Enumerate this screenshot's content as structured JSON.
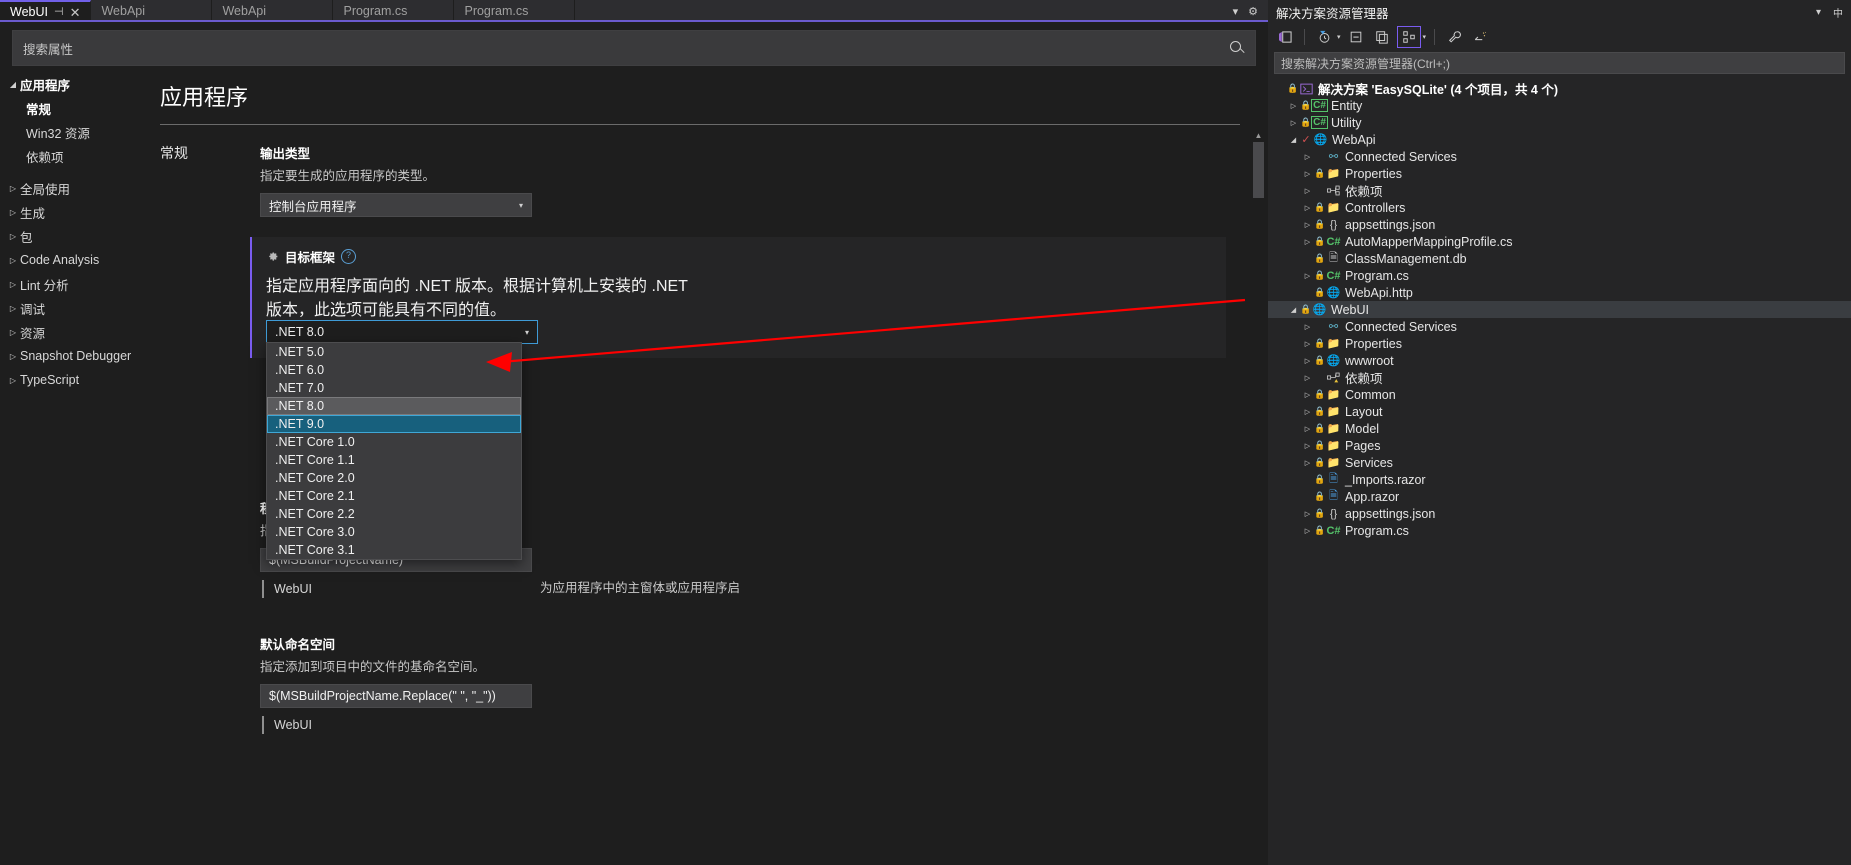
{
  "tabs": [
    {
      "label": "WebUI",
      "active": true,
      "pinned": true,
      "closable": true
    },
    {
      "label": "WebApi",
      "active": false
    },
    {
      "label": "WebApi",
      "active": false
    },
    {
      "label": "Program.cs",
      "active": false
    },
    {
      "label": "Program.cs",
      "active": false
    }
  ],
  "tabstrip": {
    "caret": "▾",
    "gear": "⚙"
  },
  "property_search": {
    "placeholder": "搜索属性"
  },
  "nav": {
    "items": [
      {
        "label": "应用程序",
        "level": 0,
        "expanded": true,
        "arrow": "◢"
      },
      {
        "label": "常规",
        "level": 1,
        "selected": true
      },
      {
        "label": "Win32 资源",
        "level": 1
      },
      {
        "label": "依赖项",
        "level": 1
      },
      {
        "label": "全局使用",
        "level": 0,
        "arrow": "▷"
      },
      {
        "label": "生成",
        "level": 0,
        "arrow": "▷"
      },
      {
        "label": "包",
        "level": 0,
        "arrow": "▷"
      },
      {
        "label": "Code Analysis",
        "level": 0,
        "arrow": "▷"
      },
      {
        "label": "Lint 分析",
        "level": 0,
        "arrow": "▷"
      },
      {
        "label": "调试",
        "level": 0,
        "arrow": "▷"
      },
      {
        "label": "资源",
        "level": 0,
        "arrow": "▷"
      },
      {
        "label": "Snapshot Debugger",
        "level": 0,
        "arrow": "▷"
      },
      {
        "label": "TypeScript",
        "level": 0,
        "arrow": "▷"
      }
    ]
  },
  "page": {
    "title": "应用程序",
    "section_name": "常规"
  },
  "fields": {
    "output_type": {
      "label": "输出类型",
      "desc": "指定要生成的应用程序的类型。",
      "value": "控制台应用程序",
      "caret": "▾"
    },
    "target_framework": {
      "label": "目标框架",
      "gear_icon": "gear-icon",
      "help_icon": "?",
      "desc": "指定应用程序面向的 .NET 版本。根据计算机上安装的 .NET 版本，此选项可能具有不同的值。",
      "value": ".NET 8.0",
      "caret": "▾",
      "options": [
        ".NET 5.0",
        ".NET 6.0",
        ".NET 7.0",
        ".NET 8.0",
        ".NET 9.0",
        ".NET Core 1.0",
        ".NET Core 1.1",
        ".NET Core 2.0",
        ".NET Core 2.1",
        ".NET Core 2.2",
        ".NET Core 3.0",
        ".NET Core 3.1"
      ],
      "hovered_option": ".NET 8.0",
      "selected_option": ".NET 9.0"
    },
    "startup_object": {
      "desc_tail": "为应用程序中的主窗体或应用程序启"
    },
    "assembly_name": {
      "label": "程序集名称",
      "desc": "指定将包含程序集清单的输出文件的名称。",
      "value": "$(MSBuildProjectName)",
      "resolved": "WebUI"
    },
    "default_namespace": {
      "label": "默认命名空间",
      "desc": "指定添加到项目中的文件的基命名空间。",
      "value": "$(MSBuildProjectName.Replace(\" \", \"_\"))",
      "resolved": "WebUI"
    }
  },
  "solution_explorer": {
    "title": "解决方案资源管理器",
    "header_caret": "▾",
    "header_pin": "中",
    "search_placeholder": "搜索解决方案资源管理器(Ctrl+;)",
    "toolbar": [
      {
        "name": "home-icon",
        "glyph": "⌂"
      },
      {
        "name": "pending-changes-icon",
        "glyph": "◔",
        "caret": true
      },
      {
        "name": "collapse-all-icon",
        "glyph": "⊟"
      },
      {
        "name": "show-all-files-icon",
        "glyph": "❐"
      },
      {
        "name": "view-switcher-icon",
        "glyph": "⁘",
        "caret": true,
        "active": true
      },
      {
        "name": "properties-wrench-icon",
        "glyph": "🔧"
      },
      {
        "name": "preview-selected-icon",
        "glyph": "⇲"
      }
    ],
    "tree": [
      {
        "label": "解决方案 'EasySQLite' (4 个项目，共 4 个)",
        "indent": 0,
        "icon": "sln-icon",
        "lock": true,
        "expander": "",
        "kind": "solution"
      },
      {
        "label": "Entity",
        "indent": 1,
        "icon": "cs-project-icon",
        "lock": true,
        "expander": "▷"
      },
      {
        "label": "Utility",
        "indent": 1,
        "icon": "cs-project-icon",
        "lock": true,
        "expander": "▷"
      },
      {
        "label": "WebApi",
        "indent": 1,
        "icon": "web-project-icon",
        "lock": false,
        "check": true,
        "expander": "◢"
      },
      {
        "label": "Connected Services",
        "indent": 2,
        "icon": "connected-services-icon",
        "expander": "▷"
      },
      {
        "label": "Properties",
        "indent": 2,
        "icon": "properties-folder-icon",
        "lock": true,
        "expander": "▷"
      },
      {
        "label": "依赖项",
        "indent": 2,
        "icon": "dependencies-icon",
        "expander": "▷"
      },
      {
        "label": "Controllers",
        "indent": 2,
        "icon": "folder-icon",
        "lock": true,
        "expander": "▷"
      },
      {
        "label": "appsettings.json",
        "indent": 2,
        "icon": "json-icon",
        "lock": true,
        "expander": "▷"
      },
      {
        "label": "AutoMapperMappingProfile.cs",
        "indent": 2,
        "icon": "cs-file-icon",
        "lock": true,
        "expander": "▷"
      },
      {
        "label": "ClassManagement.db",
        "indent": 2,
        "icon": "db-icon",
        "lock": true,
        "expander": ""
      },
      {
        "label": "Program.cs",
        "indent": 2,
        "icon": "cs-file-icon",
        "lock": true,
        "expander": "▷"
      },
      {
        "label": "WebApi.http",
        "indent": 2,
        "icon": "http-icon",
        "lock": true,
        "expander": ""
      },
      {
        "label": "WebUI",
        "indent": 1,
        "icon": "web-project-icon",
        "lock": true,
        "expander": "◢",
        "selected": true
      },
      {
        "label": "Connected Services",
        "indent": 2,
        "icon": "connected-services-icon",
        "expander": "▷"
      },
      {
        "label": "Properties",
        "indent": 2,
        "icon": "properties-folder-icon",
        "lock": true,
        "expander": "▷"
      },
      {
        "label": "wwwroot",
        "indent": 2,
        "icon": "globe-icon",
        "lock": true,
        "expander": "▷"
      },
      {
        "label": "依赖项",
        "indent": 2,
        "icon": "dependencies-warning-icon",
        "expander": "▷"
      },
      {
        "label": "Common",
        "indent": 2,
        "icon": "folder-icon",
        "lock": true,
        "expander": "▷"
      },
      {
        "label": "Layout",
        "indent": 2,
        "icon": "folder-icon",
        "lock": true,
        "expander": "▷"
      },
      {
        "label": "Model",
        "indent": 2,
        "icon": "folder-icon",
        "lock": true,
        "expander": "▷"
      },
      {
        "label": "Pages",
        "indent": 2,
        "icon": "folder-icon",
        "lock": true,
        "expander": "▷"
      },
      {
        "label": "Services",
        "indent": 2,
        "icon": "folder-icon",
        "lock": true,
        "expander": "▷"
      },
      {
        "label": "_Imports.razor",
        "indent": 2,
        "icon": "razor-icon",
        "lock": true,
        "expander": ""
      },
      {
        "label": "App.razor",
        "indent": 2,
        "icon": "razor-icon",
        "lock": true,
        "expander": ""
      },
      {
        "label": "appsettings.json",
        "indent": 2,
        "icon": "json-icon",
        "lock": true,
        "expander": "▷"
      },
      {
        "label": "Program.cs",
        "indent": 2,
        "icon": "cs-file-icon",
        "lock": true,
        "expander": "▷"
      }
    ]
  },
  "colors": {
    "accent": "#7a5cf0",
    "selection": "#17607d",
    "annotation_arrow": "#ff0000",
    "folder": "#dcb67a",
    "cs_green": "#55c36a",
    "lock_blue": "#4a9de0"
  }
}
